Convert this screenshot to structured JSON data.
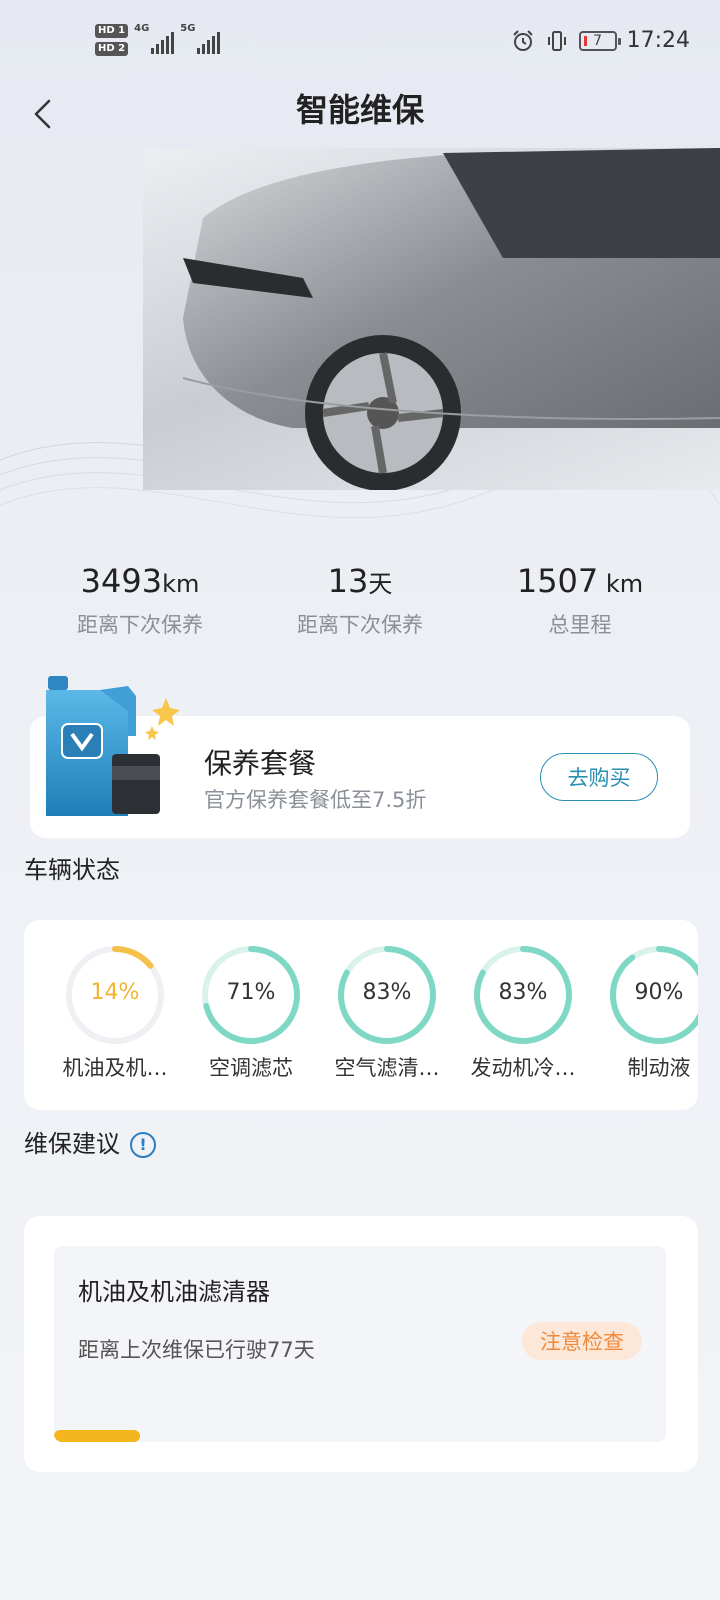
{
  "status_bar": {
    "hd1": "HD 1",
    "hd2": "HD 2",
    "net1": "4G",
    "net2": "5G",
    "battery": "7",
    "time": "17:24"
  },
  "header": {
    "title": "智能维保",
    "back_icon": "chevron-left-icon"
  },
  "stats": [
    {
      "value": "3493",
      "unit": "km",
      "label": "距离下次保养"
    },
    {
      "value": "13",
      "unit": "天",
      "label": "距离下次保养"
    },
    {
      "value": "1507",
      "unit": " km",
      "label": "总里程"
    }
  ],
  "promo": {
    "title": "保养套餐",
    "subtitle": "官方保养套餐低至7.5折",
    "button": "去购买"
  },
  "vehicle_status": {
    "title": "车辆状态",
    "items": [
      {
        "percent": "14%",
        "value": 0.14,
        "name": "机油及机…",
        "color": "#f5c04a"
      },
      {
        "percent": "71%",
        "value": 0.71,
        "name": "空调滤芯",
        "color": "#7fd8c6"
      },
      {
        "percent": "83%",
        "value": 0.83,
        "name": "空气滤清…",
        "color": "#7fd8c6"
      },
      {
        "percent": "83%",
        "value": 0.83,
        "name": "发动机冷…",
        "color": "#7fd8c6"
      },
      {
        "percent": "90%",
        "value": 0.9,
        "name": "制动液",
        "color": "#7fd8c6"
      }
    ]
  },
  "advice": {
    "title": "维保建议",
    "info_icon": "info-icon",
    "items": [
      {
        "title": "机油及机油滤清器",
        "desc": "距离上次维保已行驶77天",
        "badge": "注意检查",
        "progress": 0.14,
        "progress_color": "#f5b51d"
      }
    ]
  },
  "colors": {
    "accent": "#2a8fb3",
    "warning": "#f5b51d",
    "ok": "#7fd8c6"
  }
}
